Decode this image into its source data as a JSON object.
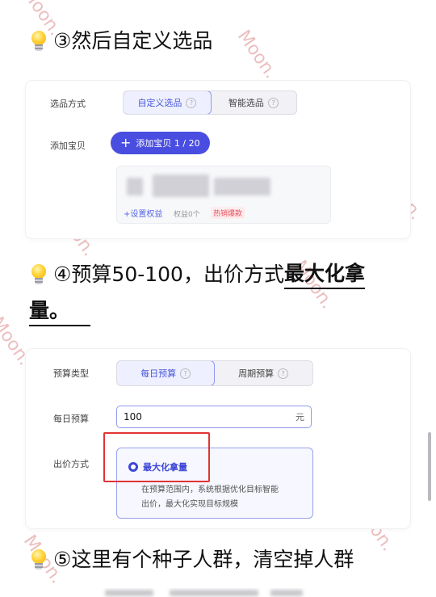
{
  "watermark_text": "Moon.",
  "step3": {
    "text": "③然后自定义选品"
  },
  "panel1": {
    "selection_label": "选品方式",
    "tab_custom": "自定义选品",
    "tab_smart": "智能选品",
    "add_label": "添加宝贝",
    "add_button": "添加宝贝 1 / 20",
    "product": {
      "set_rights": "+设置权益",
      "rights_count": "权益0个",
      "hot_tag": "热销爆款"
    }
  },
  "step4": {
    "text_plain": "④预算50-100，出价方式",
    "text_bold": "最大化拿",
    "text_bold_line2": "量。"
  },
  "panel2": {
    "budget_type_label": "预算类型",
    "tab_daily": "每日预算",
    "tab_period": "周期预算",
    "daily_budget_label": "每日预算",
    "daily_budget_value": "100",
    "currency": "元",
    "bid_label": "出价方式",
    "bid_option": "最大化拿量",
    "bid_desc_line1": "在预算范围内，系统根据优化目标智能",
    "bid_desc_line2": "出价，最大化实现目标规模"
  },
  "step5": {
    "text": "⑤这里有个种子人群，清空掉人群"
  },
  "colors": {
    "accent": "#4a4ee0",
    "highlight": "#e23333"
  }
}
